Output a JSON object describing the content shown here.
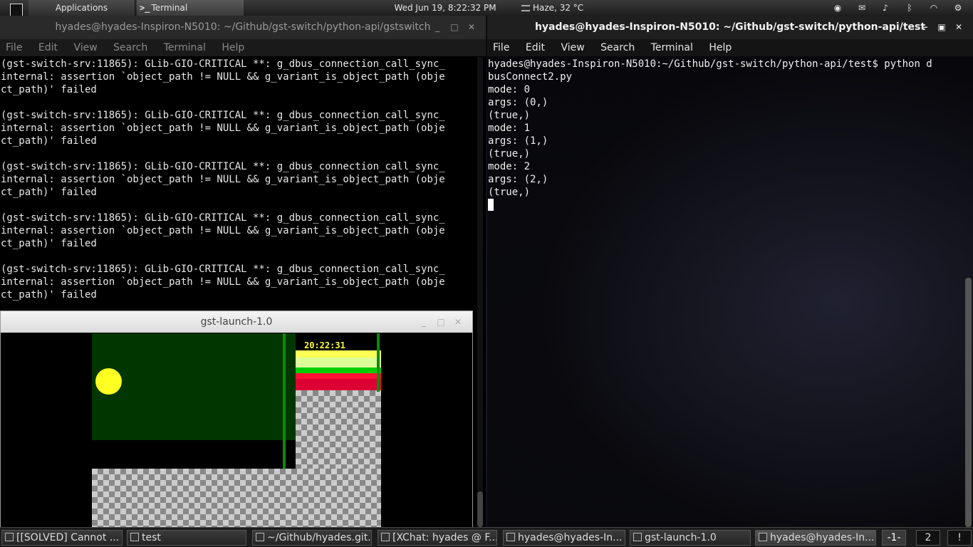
{
  "top_panel": {
    "applications": "Applications",
    "terminal_app": "Terminal",
    "clock": "Wed Jun 19,  8:22:32 PM",
    "weather": "Haze, 32 °C"
  },
  "left_terminal": {
    "title": "hyades@hyades-Inspiron-N5010: ~/Github/gst-switch/python-api/gstswitch",
    "menu": [
      "File",
      "Edit",
      "View",
      "Search",
      "Terminal",
      "Help"
    ],
    "output": "(gst-switch-srv:11865): GLib-GIO-CRITICAL **: g_dbus_connection_call_sync_\ninternal: assertion `object_path != NULL && g_variant_is_object_path (obje\nct_path)' failed\n\n(gst-switch-srv:11865): GLib-GIO-CRITICAL **: g_dbus_connection_call_sync_\ninternal: assertion `object_path != NULL && g_variant_is_object_path (obje\nct_path)' failed\n\n(gst-switch-srv:11865): GLib-GIO-CRITICAL **: g_dbus_connection_call_sync_\ninternal: assertion `object_path != NULL && g_variant_is_object_path (obje\nct_path)' failed\n\n(gst-switch-srv:11865): GLib-GIO-CRITICAL **: g_dbus_connection_call_sync_\ninternal: assertion `object_path != NULL && g_variant_is_object_path (obje\nct_path)' failed\n\n(gst-switch-srv:11865): GLib-GIO-CRITICAL **: g_dbus_connection_call_sync_\ninternal: assertion `object_path != NULL && g_variant_is_object_path (obje\nct_path)' failed"
  },
  "right_terminal": {
    "title": "hyades@hyades-Inspiron-N5010: ~/Github/gst-switch/python-api/test",
    "menu": [
      "File",
      "Edit",
      "View",
      "Search",
      "Terminal",
      "Help"
    ],
    "output": "hyades@hyades-Inspiron-N5010:~/Github/gst-switch/python-api/test$ python d\nbusConnect2.py\nmode: 0\nargs: (0,)\n(true,)\nmode: 1\nargs: (1,)\n(true,)\nmode: 2\nargs: (2,)\n(true,)\n"
  },
  "gst_window": {
    "title": "gst-launch-1.0",
    "timestamp": "20:22:31"
  },
  "taskbar": {
    "tasks": [
      "[[SOLVED] Cannot ...",
      "test",
      "~/Github/hyades.git...",
      "[XChat: hyades @ F...",
      "hyades@hyades-In...",
      "gst-launch-1.0",
      "hyades@hyades-In..."
    ],
    "workspaces": [
      "-1-",
      "2",
      "!"
    ]
  },
  "colors": {
    "video_green": "#003600",
    "sun_yellow": "#ffff22",
    "bar_colors": [
      "#ffff55",
      "#ddff99",
      "#00cc00",
      "#ff1133",
      "#dd0033"
    ]
  }
}
